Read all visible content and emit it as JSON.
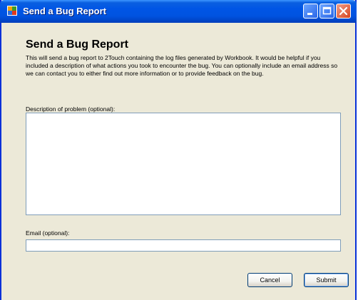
{
  "window": {
    "title": "Send a Bug Report"
  },
  "dialog": {
    "heading": "Send a Bug Report",
    "intro": "This will send a bug report to 2Touch containing the log files generated by Workbook. It would be helpful if you included a description of what actions you took to encounter the bug. You can optionally include an email address so we can contact you to either find out more information or to provide feedback on the bug.",
    "description_label": "Description of problem (optional):",
    "description_value": "",
    "email_label": "Email (optional):",
    "email_value": ""
  },
  "buttons": {
    "cancel": "Cancel",
    "submit": "Submit"
  },
  "colors": {
    "titlebar": "#0055e5",
    "window_background": "#ece9d8",
    "input_border": "#7f9db9",
    "close_button": "#d6441f"
  },
  "icons": {
    "app": "app-window-icon",
    "minimize": "minimize-icon",
    "maximize": "maximize-icon",
    "close": "close-icon"
  }
}
